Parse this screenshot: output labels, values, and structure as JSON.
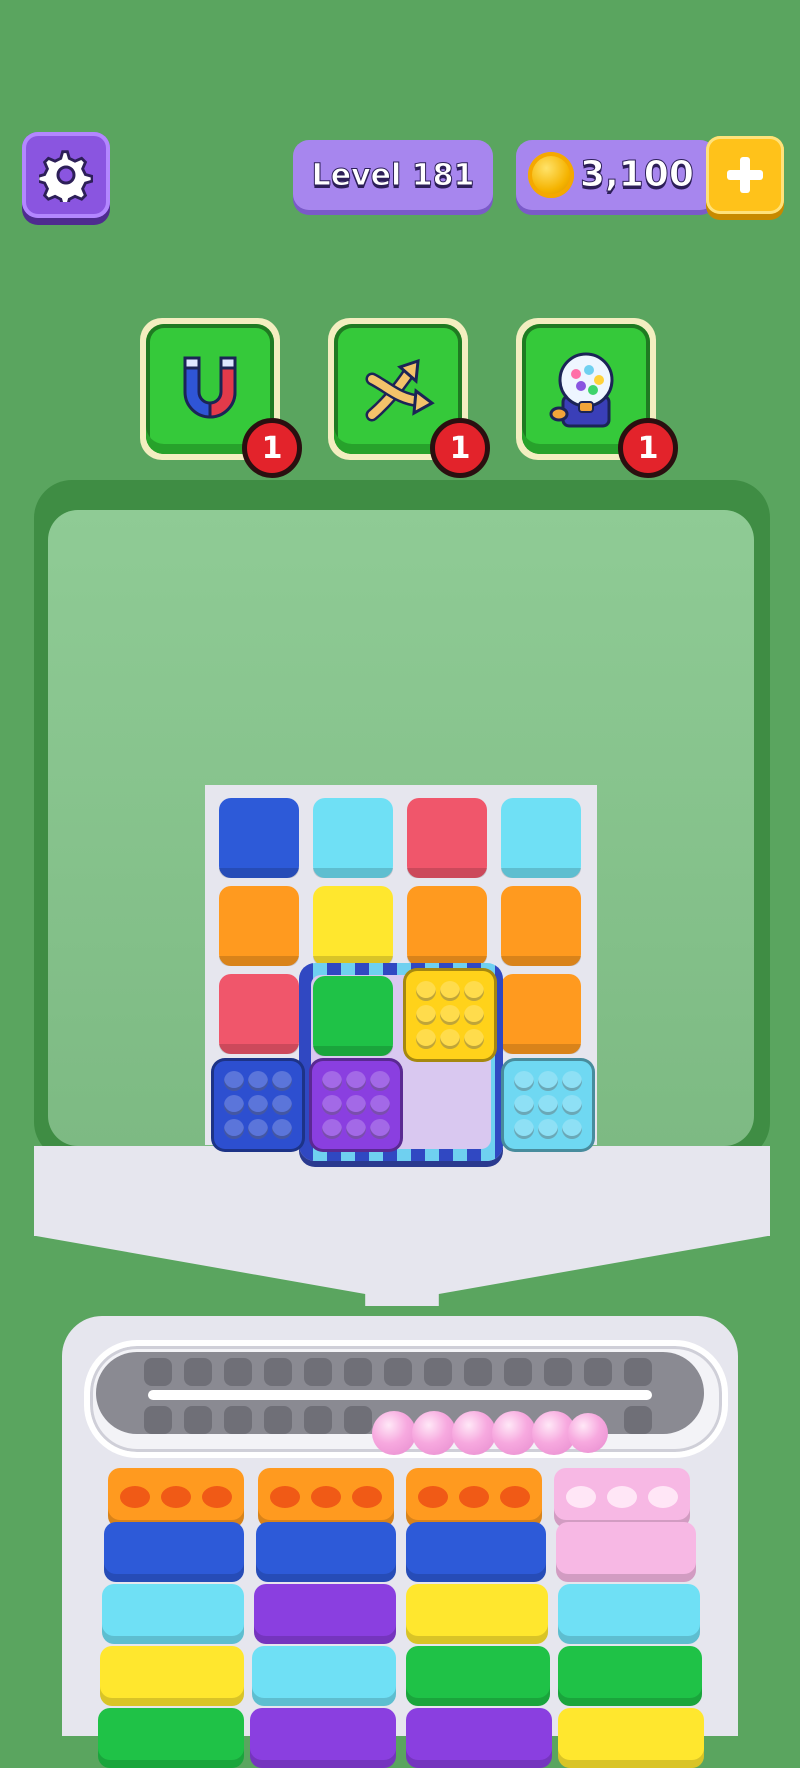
{
  "header": {
    "level_label": "Level 181",
    "coins": "3,100"
  },
  "icons": {
    "settings": "gear-icon",
    "coin": "coin-icon",
    "add_coins": "plus-icon",
    "magnet": "magnet-icon",
    "shuffle": "shuffle-arrows-icon",
    "gumball": "gumball-machine-icon"
  },
  "boosters": [
    {
      "name": "magnet",
      "count": "1"
    },
    {
      "name": "shuffle",
      "count": "1"
    },
    {
      "name": "gumball",
      "count": "1"
    }
  ],
  "colors": {
    "background": "#5aa55f",
    "purple_ui": "#a786ee",
    "gold": "#ffc21a",
    "booster_green": "#35c93a",
    "badge_red": "#e3232b"
  },
  "board": {
    "rows": [
      [
        "blue",
        "cyan",
        "red",
        "cyan"
      ],
      [
        "orange",
        "yellow",
        "orange",
        "orange"
      ],
      [
        "red",
        "green",
        "yellow-popbox",
        "orange"
      ],
      [
        "blue-popbox",
        "purple-popbox",
        "empty",
        "cyan-popbox"
      ]
    ]
  },
  "conveyor": {
    "marbles": 6,
    "marble_color": "pink"
  },
  "columns": [
    [
      "orange-holes",
      "blue",
      "cyan",
      "yellow",
      "green"
    ],
    [
      "orange-holes",
      "blue",
      "purple",
      "cyan",
      "purple"
    ],
    [
      "orange-holes",
      "blue",
      "yellow",
      "green",
      "purple"
    ],
    [
      "pink-holes",
      "pink",
      "cyan",
      "green",
      "yellow"
    ]
  ]
}
